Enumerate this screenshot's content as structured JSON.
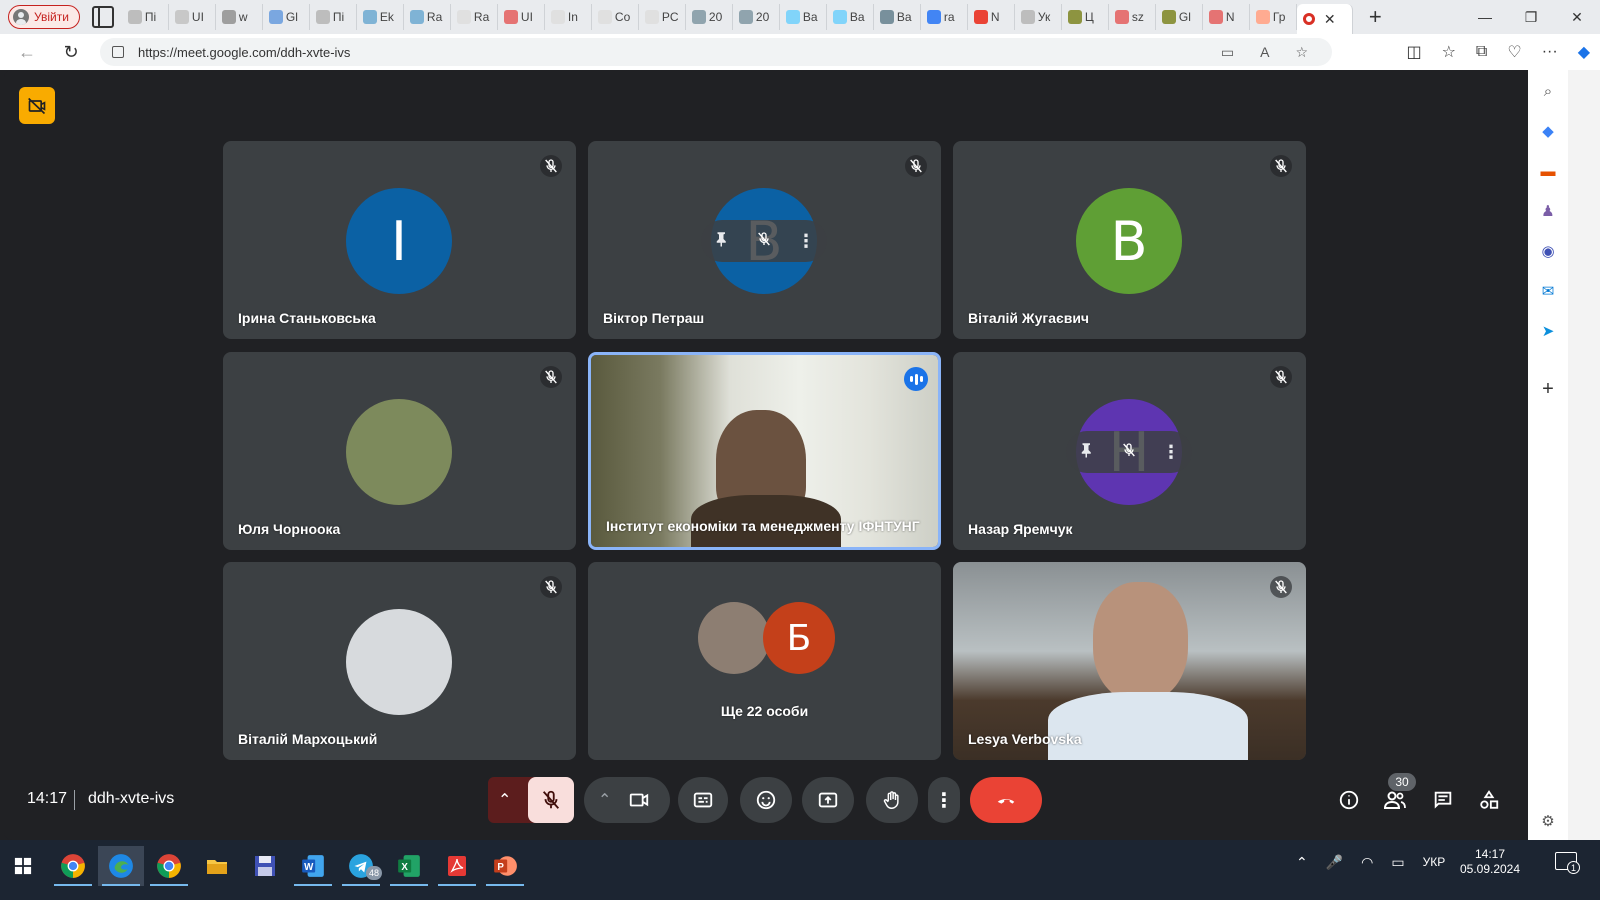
{
  "browser": {
    "profile_label": "Увійти",
    "tabs": [
      {
        "label": "Пі",
        "fav": "#bdbdbd"
      },
      {
        "label": "UI",
        "fav": "#c8c8c8"
      },
      {
        "label": "w",
        "fav": "#9e9e9e"
      },
      {
        "label": "Gl",
        "fav": "#7aa7e0"
      },
      {
        "label": "Пі",
        "fav": "#bdbdbd"
      },
      {
        "label": "Ek",
        "fav": "#7fb3d5"
      },
      {
        "label": "Ra",
        "fav": "#7fb3d5"
      },
      {
        "label": "Ra",
        "fav": "#e0e0e0"
      },
      {
        "label": "UI",
        "fav": "#e57373"
      },
      {
        "label": "In",
        "fav": "#e0e0e0"
      },
      {
        "label": "Co",
        "fav": "#e0e0e0"
      },
      {
        "label": "PC",
        "fav": "#e0e0e0"
      },
      {
        "label": "20",
        "fav": "#90a4ae"
      },
      {
        "label": "20",
        "fav": "#90a4ae"
      },
      {
        "label": "Ba",
        "fav": "#81d4fa"
      },
      {
        "label": "Ba",
        "fav": "#81d4fa"
      },
      {
        "label": "Ba",
        "fav": "#78909c"
      },
      {
        "label": "ra",
        "fav": "#4285f4"
      },
      {
        "label": "N",
        "fav": "#ea4335"
      },
      {
        "label": "Ук",
        "fav": "#bdbdbd"
      },
      {
        "label": "Ц",
        "fav": "#8d9440"
      },
      {
        "label": "sz",
        "fav": "#e57373"
      },
      {
        "label": "Gl",
        "fav": "#8d9440"
      },
      {
        "label": "N",
        "fav": "#e57373"
      },
      {
        "label": "Гр",
        "fav": "#ffab91"
      }
    ],
    "url": "https://meet.google.com/ddh-xvte-ivs"
  },
  "meet": {
    "participants": [
      {
        "name": "Ірина Станьковська",
        "initial": "І",
        "color": "#0b61a4",
        "muted": true
      },
      {
        "name": "Віктор Петраш",
        "initial": "В",
        "color": "#0b61a4",
        "muted": true,
        "hover": true
      },
      {
        "name": "Віталій Жугаєвич",
        "initial": "В",
        "color": "#5f9f35",
        "muted": true
      },
      {
        "name": "Юля Чорноока",
        "initial": "",
        "color": "#7d8a5c",
        "muted": true
      },
      {
        "name": "Інститут економіки та менеджменту ІФНТУНГ",
        "initial": "",
        "color": "",
        "muted": false,
        "speaking": true
      },
      {
        "name": "Назар Яремчук",
        "initial": "Н",
        "color": "#5e35b1",
        "muted": true,
        "hover": true
      },
      {
        "name": "Віталій Мархоцький",
        "initial": "",
        "color": "#d7dadd",
        "muted": true
      },
      {
        "name": "Ще 22 особи",
        "initial": "Б",
        "color": "#c4401a",
        "muted": false
      },
      {
        "name": "Lesya Verbovska",
        "initial": "",
        "color": "",
        "muted": true
      }
    ],
    "clock": "14:17",
    "meeting_code": "ddh-xvte-ivs",
    "people_count": "30"
  },
  "taskbar": {
    "lang": "УКР",
    "time": "14:17",
    "date": "05.09.2024",
    "telegram_badge": "48",
    "notifications": "1"
  }
}
